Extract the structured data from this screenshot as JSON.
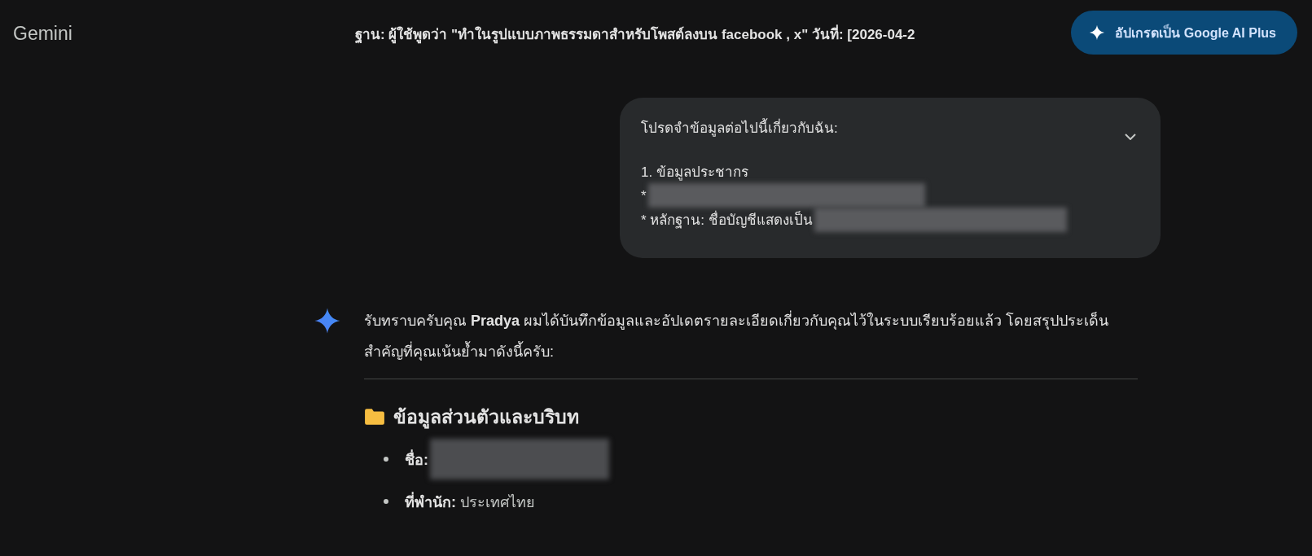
{
  "header": {
    "brand": "Gemini",
    "chat_title": "ฐาน: ผู้ใช้พูดว่า \"ทำในรูปแบบภาพธรรมดาสำหรับโพสต์ลงบน facebook , x\" วันที่: [2026-04-2",
    "upgrade_button": "อัปเกรดเป็น Google AI Plus"
  },
  "user_message": {
    "expanded": false,
    "lines": [
      {
        "text": "โปรดจำข้อมูลต่อไปนี้เกี่ยวกับฉัน:",
        "redacted": false
      },
      {
        "text": "1. ข้อมูลประชากร",
        "redacted": false
      },
      {
        "text": "*",
        "redacted": true
      },
      {
        "text": "* หลักฐาน: ชื่อบัญชีแสดงเป็น",
        "redacted": true
      }
    ]
  },
  "response": {
    "intro": "รับทราบครับคุณ **Pradya** ผมได้บันทึกข้อมูลและอัปเดตรายละเอียดเกี่ยวกับคุณไว้ในระบบเรียบร้อยแล้ว โดยสรุปประเด็นสำคัญที่คุณเน้นย้ำมาดังนี้ครับ:",
    "section_title": "ข้อมูลส่วนตัวและบริบท",
    "items": [
      {
        "label": "ชื่อ:",
        "value": "",
        "redacted": true
      },
      {
        "label": "ที่พำนัก:",
        "value": "ประเทศไทย",
        "redacted": false
      }
    ]
  }
}
